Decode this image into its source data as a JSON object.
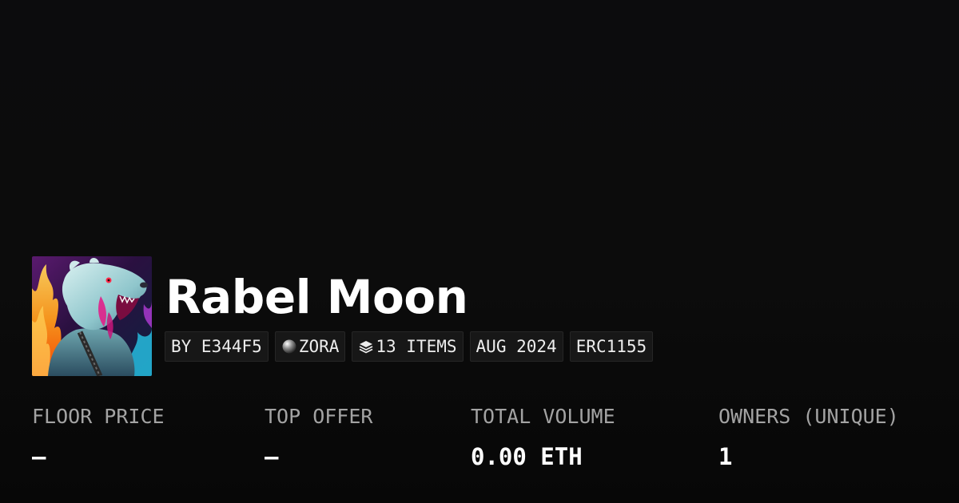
{
  "collection": {
    "name": "Rabel Moon",
    "avatar_icon": "werebear-artwork-avatar"
  },
  "tags": [
    {
      "label": "BY E344F5"
    },
    {
      "label": "ZORA",
      "icon": "zora-orb-icon"
    },
    {
      "label": "13 ITEMS",
      "icon": "layers-icon"
    },
    {
      "label": "AUG 2024"
    },
    {
      "label": "ERC1155"
    }
  ],
  "stats": [
    {
      "label": "FLOOR PRICE",
      "value": "—"
    },
    {
      "label": "TOP OFFER",
      "value": "—"
    },
    {
      "label": "TOTAL VOLUME",
      "value": "0.00 ETH"
    },
    {
      "label": "OWNERS (UNIQUE)",
      "value": "1"
    }
  ],
  "colors": {
    "background": "#0b0b0b",
    "tag_background": "#171717",
    "label_gray": "#a3a3a3",
    "text_white": "#ffffff"
  }
}
